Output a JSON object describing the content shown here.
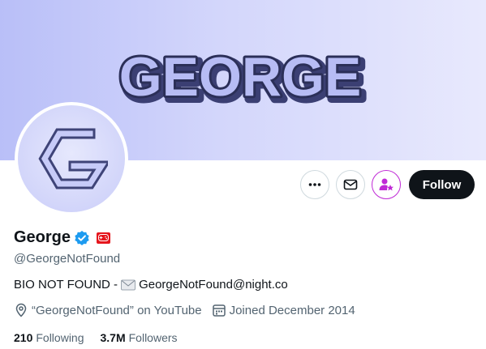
{
  "banner": {
    "title": "GEORGE"
  },
  "profile": {
    "display_name": "George",
    "handle": "@GeorgeNotFound",
    "bio_prefix": "BIO NOT FOUND - ",
    "bio_email": "GeorgeNotFound@night.co",
    "location": "“GeorgeNotFound” on YouTube",
    "joined": "Joined December 2014"
  },
  "stats": {
    "following_count": "210",
    "following_label": "Following",
    "followers_count": "3.7M",
    "followers_label": "Followers"
  },
  "actions": {
    "follow_label": "Follow"
  },
  "colors": {
    "accent": "#0f1419",
    "verified": "#1d9bf0",
    "subscribe": "#c02ad6",
    "gamepad": "#e5161d"
  }
}
